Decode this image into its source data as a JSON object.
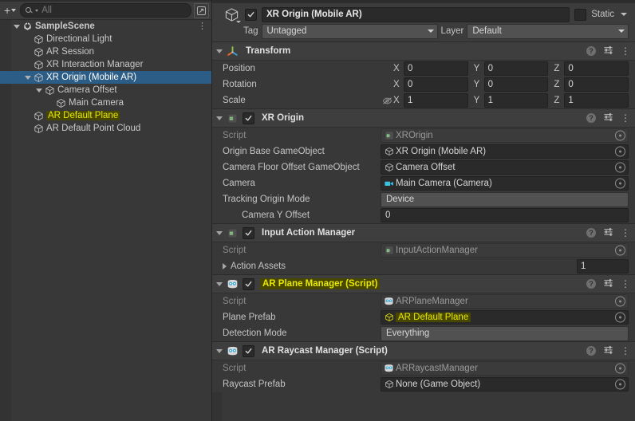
{
  "hierarchy": {
    "toolbar": {
      "create_label": "+",
      "search_placeholder": "All",
      "search_value": "",
      "search_icon": "search-icon",
      "popout_icon": "popout-icon"
    },
    "rows": [
      {
        "label": "SampleScene",
        "depth": 0,
        "icon": "unity-scene-icon",
        "foldout": "down",
        "selected": false,
        "highlight": false,
        "kebab": "⋮"
      },
      {
        "label": "Directional Light",
        "depth": 1,
        "icon": "gameobject-cube-icon",
        "foldout": "none",
        "selected": false,
        "highlight": false
      },
      {
        "label": "AR Session",
        "depth": 1,
        "icon": "gameobject-cube-icon",
        "foldout": "none",
        "selected": false,
        "highlight": false
      },
      {
        "label": "XR Interaction Manager",
        "depth": 1,
        "icon": "gameobject-cube-icon",
        "foldout": "none",
        "selected": false,
        "highlight": false
      },
      {
        "label": "XR Origin (Mobile AR)",
        "depth": 1,
        "icon": "gameobject-cube-icon",
        "foldout": "down",
        "selected": true,
        "highlight": false
      },
      {
        "label": "Camera Offset",
        "depth": 2,
        "icon": "gameobject-cube-icon",
        "foldout": "down",
        "selected": false,
        "highlight": false
      },
      {
        "label": "Main Camera",
        "depth": 3,
        "icon": "gameobject-cube-icon",
        "foldout": "none",
        "selected": false,
        "highlight": false
      },
      {
        "label": "AR Default Plane",
        "depth": 1,
        "icon": "gameobject-cube-icon",
        "foldout": "none",
        "selected": false,
        "highlight": true
      },
      {
        "label": "AR Default Point Cloud",
        "depth": 1,
        "icon": "gameobject-cube-icon",
        "foldout": "none",
        "selected": false,
        "highlight": false
      }
    ]
  },
  "inspector": {
    "gameobject": {
      "enabled": true,
      "name": "XR Origin (Mobile AR)",
      "static_label": "Static",
      "static_checked": false,
      "tag_label": "Tag",
      "tag_value": "Untagged",
      "layer_label": "Layer",
      "layer_value": "Default",
      "icon": "gameobject-cube-icon"
    },
    "components": [
      {
        "title": "Transform",
        "icon": "transform-gizmo-icon",
        "has_checkbox": false,
        "highlight_title": false,
        "rows": [
          {
            "kind": "vector3",
            "label": "Position",
            "eye_off": false,
            "axes": [
              "X",
              "Y",
              "Z"
            ],
            "values": [
              "0",
              "0",
              "0"
            ]
          },
          {
            "kind": "vector3",
            "label": "Rotation",
            "eye_off": false,
            "axes": [
              "X",
              "Y",
              "Z"
            ],
            "values": [
              "0",
              "0",
              "0"
            ]
          },
          {
            "kind": "vector3",
            "label": "Scale",
            "eye_off": true,
            "axes": [
              "X",
              "Y",
              "Z"
            ],
            "values": [
              "1",
              "1",
              "1"
            ]
          }
        ]
      },
      {
        "title": "XR Origin",
        "icon": "csharp-script-icon",
        "has_checkbox": true,
        "enabled": true,
        "highlight_title": false,
        "rows": [
          {
            "kind": "object",
            "label": "Script",
            "label_dim": true,
            "dim": true,
            "icon": "csharp-script-icon",
            "value": "XROrigin",
            "highlight_value": false
          },
          {
            "kind": "object",
            "label": "Origin Base GameObject",
            "label_dim": false,
            "dim": false,
            "icon": "gameobject-cube-icon",
            "value": "XR Origin (Mobile AR)",
            "highlight_value": false
          },
          {
            "kind": "object",
            "label": "Camera Floor Offset GameObject",
            "label_dim": false,
            "dim": false,
            "icon": "gameobject-cube-icon",
            "value": "Camera Offset",
            "highlight_value": false
          },
          {
            "kind": "object",
            "label": "Camera",
            "label_dim": false,
            "dim": false,
            "icon": "camera-icon",
            "value": "Main Camera (Camera)",
            "highlight_value": false
          },
          {
            "kind": "dropdown",
            "label": "Tracking Origin Mode",
            "label_dim": false,
            "value": "Device"
          },
          {
            "kind": "text",
            "label": "Camera Y Offset",
            "label_dim": false,
            "indent": true,
            "value": "0"
          }
        ]
      },
      {
        "title": "Input Action Manager",
        "icon": "csharp-script-icon",
        "has_checkbox": true,
        "enabled": true,
        "highlight_title": false,
        "rows": [
          {
            "kind": "object",
            "label": "Script",
            "label_dim": true,
            "dim": true,
            "icon": "csharp-script-icon",
            "value": "InputActionManager",
            "highlight_value": false
          },
          {
            "kind": "arraysize",
            "label": "Action Assets",
            "label_dim": false,
            "arrow": "right",
            "value": "1"
          }
        ]
      },
      {
        "title": "AR Plane Manager (Script)",
        "icon": "ar-manager-icon",
        "has_checkbox": true,
        "enabled": true,
        "highlight_title": true,
        "rows": [
          {
            "kind": "object",
            "label": "Script",
            "label_dim": true,
            "dim": true,
            "icon": "ar-manager-icon",
            "value": "ARPlaneManager",
            "highlight_value": false
          },
          {
            "kind": "object",
            "label": "Plane Prefab",
            "label_dim": false,
            "dim": false,
            "icon": "prefab-icon",
            "value": "AR Default Plane",
            "highlight_value": true
          },
          {
            "kind": "dropdown",
            "label": "Detection Mode",
            "label_dim": false,
            "value": "Everything"
          }
        ]
      },
      {
        "title": "AR Raycast Manager (Script)",
        "icon": "ar-manager-icon",
        "has_checkbox": true,
        "enabled": true,
        "highlight_title": false,
        "rows": [
          {
            "kind": "object",
            "label": "Script",
            "label_dim": true,
            "dim": true,
            "icon": "ar-manager-icon",
            "value": "ARRaycastManager",
            "highlight_value": false
          },
          {
            "kind": "object",
            "label": "Raycast Prefab",
            "label_dim": false,
            "dim": false,
            "icon": "gameobject-cube-icon",
            "value": "None (Game Object)",
            "highlight_value": false
          }
        ]
      }
    ],
    "header_icons": {
      "help": "?",
      "preset": "preset-icon",
      "menu": "⋮"
    }
  },
  "colors": {
    "selection_blue": "#2c5d87",
    "highlight_yellow": "#e8e800",
    "highlight_bg": "#474700",
    "panel_bg": "#383838",
    "field_bg": "#2a2a2a"
  }
}
